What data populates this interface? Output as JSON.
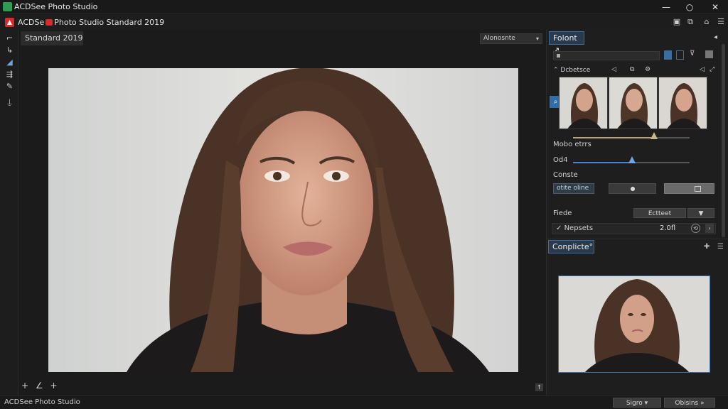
{
  "window": {
    "title": "ACDSee Photo Studio",
    "controls": {
      "minimize": "—",
      "maximize": "○",
      "close": "✕"
    }
  },
  "appbar": {
    "brand": "ACDSe",
    "brand_rest": "Photo Studio Standard 2019"
  },
  "left_tools": [
    "⌐",
    "↳",
    "◢",
    "⇶",
    "✎",
    "⍊"
  ],
  "viewer": {
    "mode_chip": "Standard 2019",
    "mode_select": "Alonosnte",
    "bottom_tools": [
      "+",
      "∠",
      "+"
    ],
    "corner_btn": "↑"
  },
  "panel_top": {
    "tab": "Folont",
    "tab_icon": "↗",
    "section": "Dcbetsce",
    "side_btn": "⌕",
    "slider1_label": "Mobo etrrs",
    "slider2_label": "Od4",
    "row3_label": "Conste",
    "input_value": "otite oline",
    "row4_label": "Fiede",
    "row4_btn": "Ectteet",
    "row5_label": "Nepsets",
    "row5_value": "2.0fl"
  },
  "panel_bottom": {
    "tab": "Conplicte°"
  },
  "statusbar": {
    "text": "ACDSee Photo Studio",
    "btn1": "Sigro",
    "btn2": "Obisins"
  },
  "colors": {
    "accent": "#3b6e9c",
    "background": "#1b1b1c",
    "slider_gold": "#b7a67a",
    "slider_blue": "#4b84c5"
  }
}
